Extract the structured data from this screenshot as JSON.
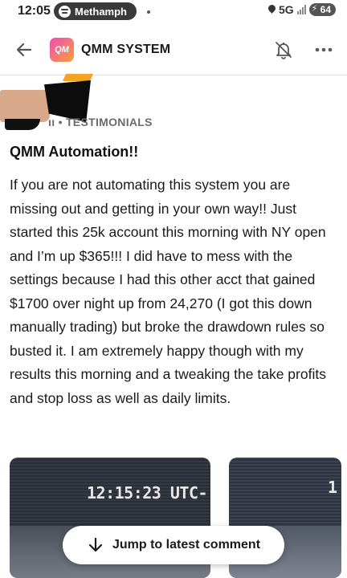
{
  "status_bar": {
    "time": "12:05",
    "media_app": "Methamph",
    "network": "5G",
    "battery": "64"
  },
  "app_bar": {
    "group_logo_text": "QM",
    "group_name": "QMM SYSTEM",
    "icons": [
      "back-arrow-icon",
      "bell-muted-icon",
      "more-horizontal-icon"
    ]
  },
  "post": {
    "category_label": "ıı • TESTIMONIALS",
    "title": "QMM Automation!!",
    "body": "If you are not automating this system you are missing out and getting in your own way!! Just started this 25k account this morning with NY open and I’m up $365!!! I did have to mess with the settings because I had this other acct that gained $1700 over night up from 24,270 (I got this down manually trading) but broke the drawdown rules so busted it. I am extremely happy though with my results this morning and a tweaking the take profits and stop loss as well as daily limits."
  },
  "attachments": [
    {
      "timestamp_text": "12:15:23 UTC-"
    },
    {
      "timestamp_text": "1"
    }
  ],
  "jump_button": {
    "label": "Jump to latest comment"
  },
  "colors": {
    "logo_start": "#f14bb3",
    "logo_end": "#f7a038",
    "redact_orange": "#f4a327"
  }
}
